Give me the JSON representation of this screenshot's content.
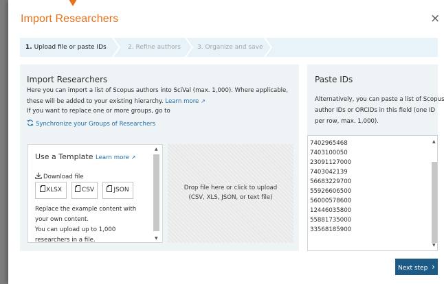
{
  "modal": {
    "title": "Import Researchers",
    "close_glyph": "×",
    "accent_color": "#e9711c"
  },
  "stepper": {
    "steps": [
      {
        "number": "1.",
        "label": "Upload file or paste IDs",
        "state": "active"
      },
      {
        "number": "2.",
        "label": "Refine authors",
        "state": "inactive"
      },
      {
        "number": "3.",
        "label": "Organize and save",
        "state": "inactive"
      }
    ]
  },
  "import_panel": {
    "title": "Import Researchers",
    "line1": "Here you can import a list of Scopus authors into SciVal (max. 1,000). Where applicable,",
    "line2_text": "these will be added to your existing hierarchy.",
    "learn_more": "Learn more",
    "line3": "If you want to replace one or more groups, go to",
    "sync_link": "Synchronize your Groups of Researchers"
  },
  "template": {
    "title": "Use a Template",
    "learn_more": "Learn more",
    "download_label": "Download file",
    "formats": [
      "XLSX",
      "CSV",
      "JSON"
    ],
    "text_lines": [
      "Replace the example content with",
      "your own content.",
      "You can upload up to 1,000",
      "researchers in a file."
    ]
  },
  "drop_zone": {
    "line1": "Drop file here or click to upload",
    "line2": "(CSV, XLS, JSON, or text file)"
  },
  "paste_panel": {
    "title": "Paste IDs",
    "desc_lines": [
      "Alternatively, you can paste a list of Scopus",
      "author IDs or ORCIDs in this field (one ID",
      "per row, max. 1,000)."
    ],
    "ids": [
      "7402965468",
      "7403100050",
      "23091127000",
      "7403042139",
      "56683229700",
      "55926606500",
      "56000578600",
      "12446035800",
      "55881735000",
      "33568185900"
    ]
  },
  "footer": {
    "next_label": "Next step",
    "next_glyph": "›",
    "button_color": "#1d5b86"
  },
  "icons": {
    "download": "download-icon",
    "sync": "sync-icon",
    "file": "file-icon",
    "external": "external-link-icon"
  }
}
